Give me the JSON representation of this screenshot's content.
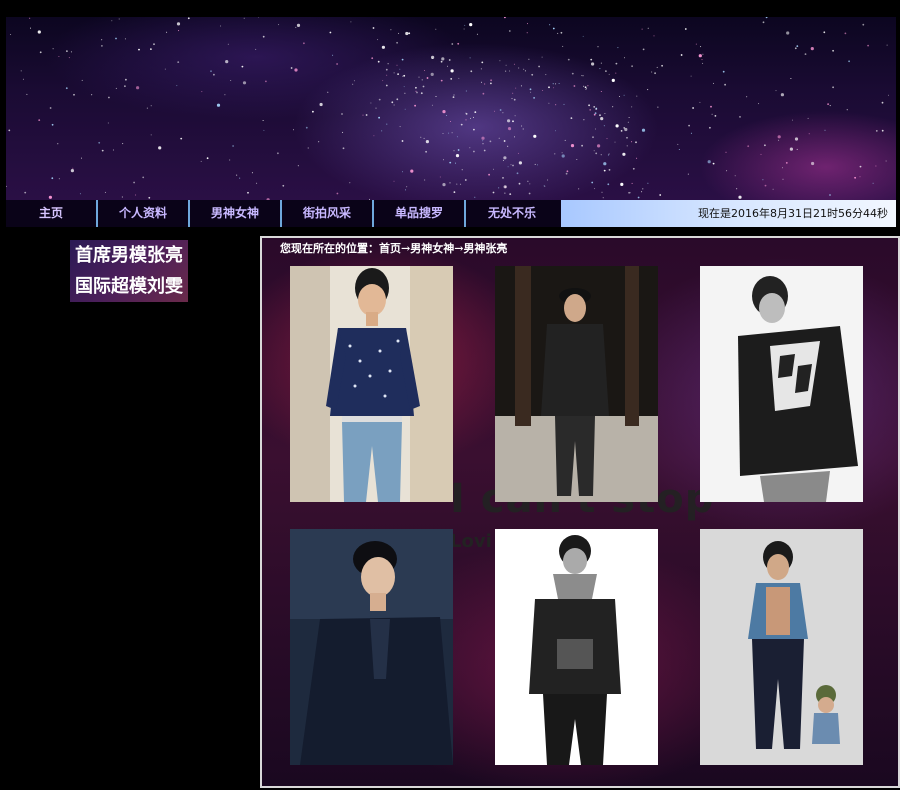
{
  "nav": {
    "items": [
      {
        "label": "主页"
      },
      {
        "label": "个人资料"
      },
      {
        "label": "男神女神"
      },
      {
        "label": "街拍风采"
      },
      {
        "label": "单品搜罗"
      },
      {
        "label": "无处不乐"
      }
    ]
  },
  "clock": "现在是2016年8月31日21时56分44秒",
  "sidebar": {
    "links": [
      "首席男模张亮",
      "国际超模刘雯"
    ]
  },
  "breadcrumb": {
    "prefix": "您现在所在的位置：",
    "items": [
      "首页",
      "男神女神",
      "男神张亮"
    ],
    "separator": "→"
  },
  "background_text": {
    "line1": "I can't stop",
    "line2": "Lovi                ding"
  },
  "photos": [
    {
      "name": "photo-1"
    },
    {
      "name": "photo-2"
    },
    {
      "name": "photo-3"
    },
    {
      "name": "photo-4"
    },
    {
      "name": "photo-5"
    },
    {
      "name": "photo-6"
    }
  ]
}
